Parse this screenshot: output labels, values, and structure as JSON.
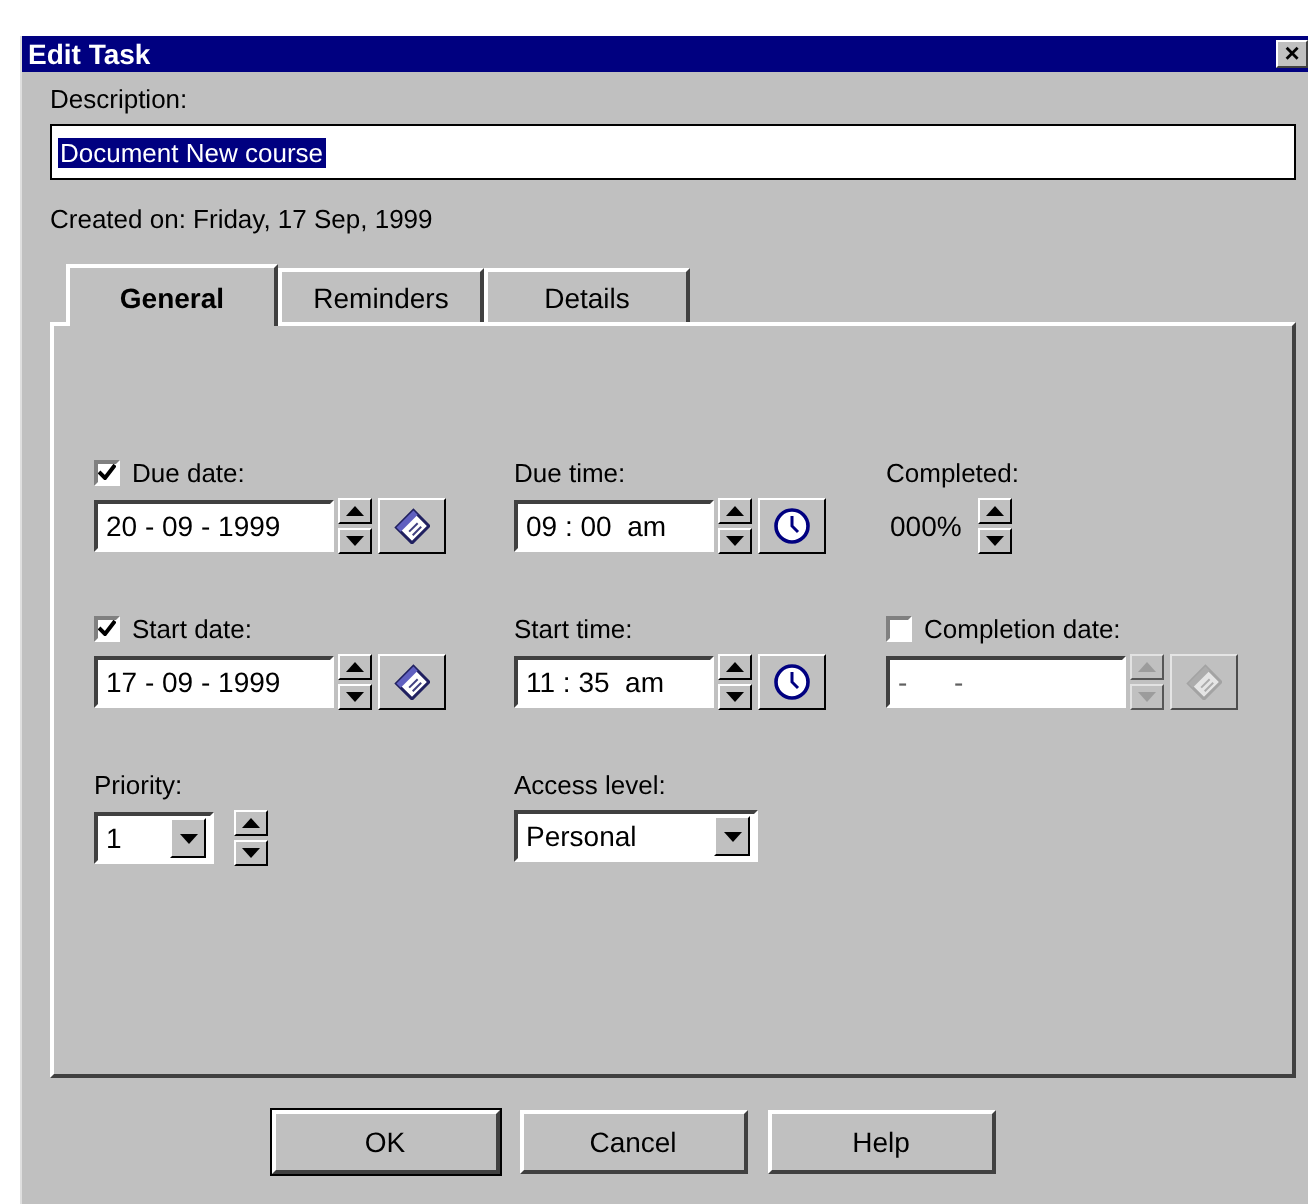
{
  "window": {
    "title": "Edit Task",
    "close": "×"
  },
  "description": {
    "label": "Description:",
    "value": "Document New course",
    "selected": true
  },
  "created": "Created on: Friday, 17 Sep, 1999",
  "tabs": [
    {
      "label": "General",
      "selected": true
    },
    {
      "label": "Reminders",
      "selected": false
    },
    {
      "label": "Details",
      "selected": false
    }
  ],
  "fields": [
    {
      "kind": "date",
      "label": "Due date:",
      "checked": true,
      "value": "20 - 09 - 1999",
      "disabled": false
    },
    {
      "kind": "time",
      "label": "Due time:",
      "value": "09 : 00  am",
      "disabled": false
    },
    {
      "kind": "percent",
      "label": "Completed:",
      "value": "000%",
      "disabled": false
    },
    {
      "kind": "date",
      "label": "Start date:",
      "checked": true,
      "value": "17 - 09 - 1999",
      "disabled": false
    },
    {
      "kind": "time",
      "label": "Start time:",
      "value": "11 : 35  am",
      "disabled": false
    },
    {
      "kind": "date",
      "label": "Completion date:",
      "checked": false,
      "value": "-      -",
      "disabled": true
    },
    {
      "kind": "priority",
      "label": "Priority:",
      "value": "1",
      "disabled": false
    },
    {
      "kind": "select",
      "label": "Access level:",
      "value": "Personal",
      "disabled": false
    }
  ],
  "buttons": [
    {
      "label": "OK",
      "default": true
    },
    {
      "label": "Cancel",
      "default": false
    },
    {
      "label": "Help",
      "default": false
    }
  ]
}
